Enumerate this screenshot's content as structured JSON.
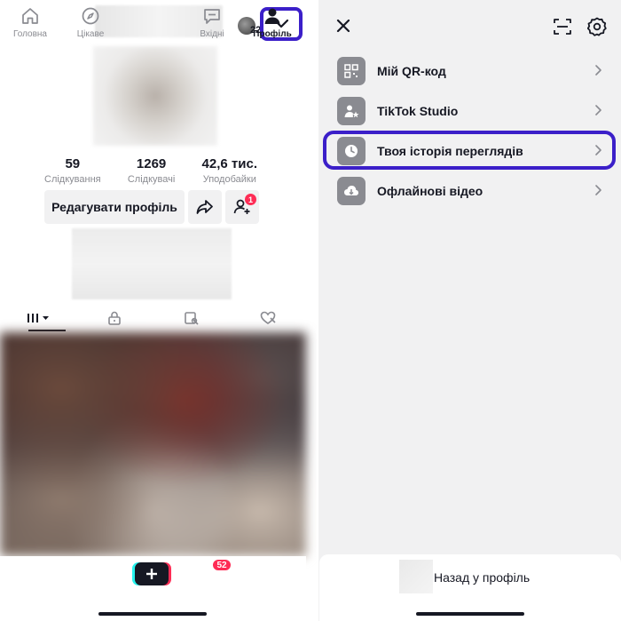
{
  "profile": {
    "follower_avatar_count": "22",
    "stats": [
      {
        "value": "59",
        "label": "Слідкування"
      },
      {
        "value": "1269",
        "label": "Слідкувачі"
      },
      {
        "value": "42,6 тис.",
        "label": "Уподобайки"
      }
    ],
    "edit_profile_label": "Редагувати профіль",
    "friend_badge": "1",
    "tabs": [
      {
        "icon": "grid-icon",
        "active": true
      },
      {
        "icon": "lock-icon",
        "active": false
      },
      {
        "icon": "saved-icon",
        "active": false
      },
      {
        "icon": "liked-icon",
        "active": false
      }
    ]
  },
  "bottom_nav": {
    "home": "Головна",
    "discover": "Цікаве",
    "inbox": "Вхідні",
    "inbox_badge": "52",
    "profile": "Профіль"
  },
  "menu": {
    "items": [
      {
        "label": "Мій QR-код",
        "icon": "qr-code-icon"
      },
      {
        "label": "TikTok Studio",
        "icon": "studio-icon"
      },
      {
        "label": "Твоя історія переглядів",
        "icon": "clock-icon"
      },
      {
        "label": "Офлайнові відео",
        "icon": "download-icon"
      }
    ],
    "back_to_profile": "Назад у профіль"
  },
  "colors": {
    "highlight": "#3b1fc9",
    "badge": "#fe2c55",
    "text": "#161823",
    "secondary": "#8a8b91",
    "panel_bg": "#f1f1f2"
  }
}
